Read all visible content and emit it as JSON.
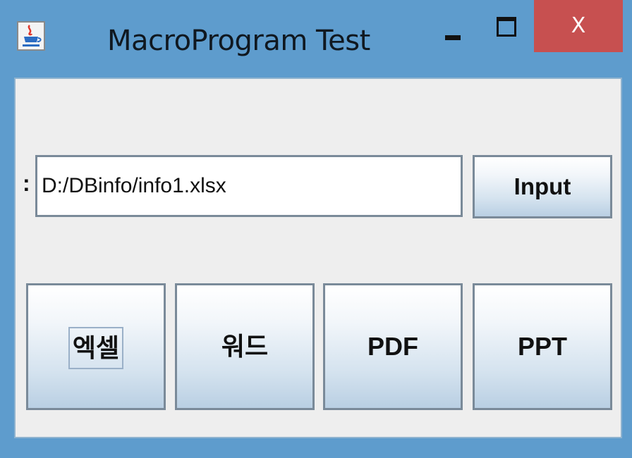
{
  "window": {
    "title": "MacroProgram Test",
    "close_glyph": "X",
    "icons": {
      "app": "java-cup-icon",
      "minimize": "minimize-icon",
      "maximize": "maximize-icon",
      "close": "close-icon"
    },
    "colors": {
      "frame": "#5e9ccd",
      "close_button": "#c75050",
      "panel": "#eeeeee"
    }
  },
  "form": {
    "label": ":",
    "path_value": "D:/DBinfo/info1.xlsx",
    "input_button_label": "Input"
  },
  "actions": {
    "excel_label": "엑셀",
    "word_label": "워드",
    "pdf_label": "PDF",
    "ppt_label": "PPT"
  }
}
